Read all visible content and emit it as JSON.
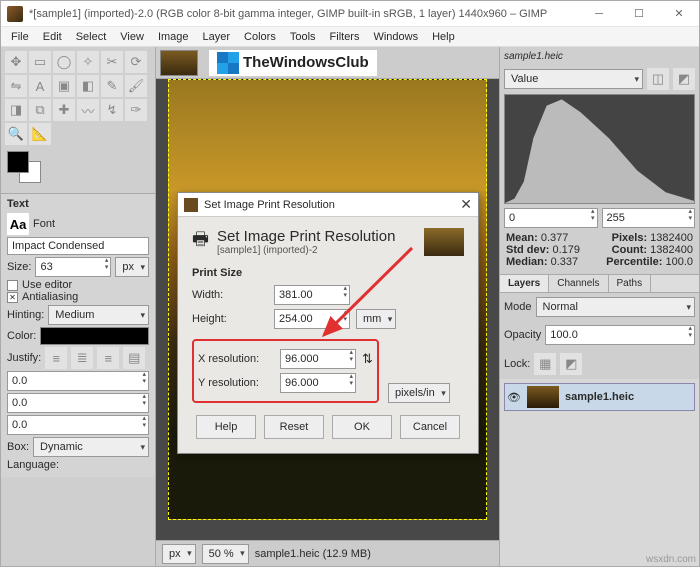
{
  "window": {
    "title": "*[sample1] (imported)-2.0 (RGB color 8-bit gamma integer, GIMP built-in sRGB, 1 layer) 1440x960 – GIMP"
  },
  "menu": [
    "File",
    "Edit",
    "Select",
    "View",
    "Image",
    "Layer",
    "Colors",
    "Tools",
    "Filters",
    "Windows",
    "Help"
  ],
  "logo": "TheWindowsClub",
  "text": {
    "hdr": "Text",
    "font_lbl": "Font",
    "font": "Impact Condensed",
    "size_lbl": "Size:",
    "size": "63",
    "unit": "px",
    "editor": "Use editor",
    "aa": "Antialiasing",
    "hint_lbl": "Hinting:",
    "hint": "Medium",
    "color_lbl": "Color:",
    "justify_lbl": "Justify:",
    "sp1": "0.0",
    "sp2": "0.0",
    "sp3": "0.0",
    "box_lbl": "Box:",
    "box": "Dynamic",
    "lang_lbl": "Language:"
  },
  "right": {
    "file": "sample1.heic",
    "channel": "Value",
    "range_lo": "0",
    "range_hi": "255",
    "mean_l": "Mean:",
    "mean": "0.377",
    "pixels_l": "Pixels:",
    "pixels": "1382400",
    "std_l": "Std dev:",
    "std": "0.179",
    "count_l": "Count:",
    "count": "1382400",
    "med_l": "Median:",
    "med": "0.337",
    "pct_l": "Percentile:",
    "pct": "100.0",
    "tabs": [
      "Layers",
      "Channels",
      "Paths"
    ],
    "mode_l": "Mode",
    "mode": "Normal",
    "opacity_l": "Opacity",
    "opacity": "100.0",
    "lock_l": "Lock:",
    "layer": "sample1.heic"
  },
  "status": {
    "unit": "px",
    "zoom": "50 %",
    "info": "sample1.heic (12.9 MB)"
  },
  "dialog": {
    "title": "Set Image Print Resolution",
    "heading": "Set Image Print Resolution",
    "sub": "[sample1] (imported)-2",
    "print_size": "Print Size",
    "width_l": "Width:",
    "width": "381.00",
    "height_l": "Height:",
    "height": "254.00",
    "unit1": "mm",
    "xres_l": "X resolution:",
    "xres": "96.000",
    "yres_l": "Y resolution:",
    "yres": "96.000",
    "unit2": "pixels/in",
    "help": "Help",
    "reset": "Reset",
    "ok": "OK",
    "cancel": "Cancel"
  },
  "wm": "wsxdn.com"
}
